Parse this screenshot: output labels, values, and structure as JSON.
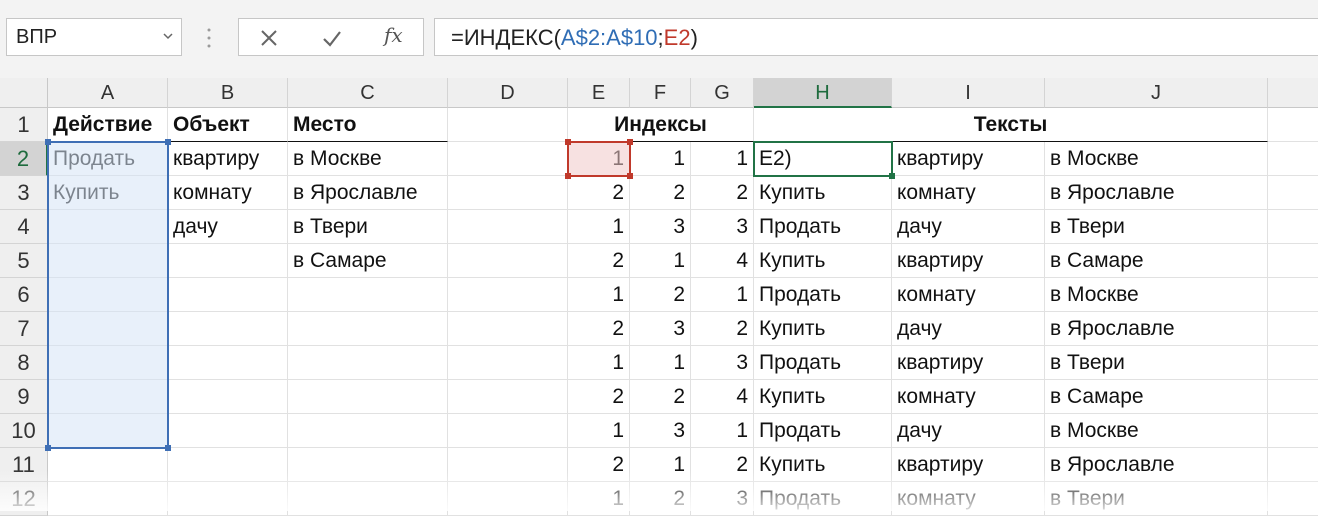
{
  "name_box": {
    "value": "ВПР"
  },
  "formula_bar": {
    "prefix": "=ИНДЕКС(",
    "ref1": "A$2:A$10",
    "sep": ";",
    "ref2": "E2",
    "suffix": ")",
    "cancel_icon": "close-icon",
    "enter_icon": "check-icon",
    "function_icon": "fx-icon",
    "fx_label": "fx"
  },
  "columns": [
    "A",
    "B",
    "C",
    "D",
    "E",
    "F",
    "G",
    "H",
    "I",
    "J"
  ],
  "active_column": "H",
  "rows": [
    "1",
    "2",
    "3",
    "4",
    "5",
    "6",
    "7",
    "8",
    "9",
    "10",
    "11",
    "12"
  ],
  "active_row": "2",
  "header_row": {
    "A": "Действие",
    "B": "Объект",
    "C": "Место",
    "EFG": "Индексы",
    "HIJ": "Тексты"
  },
  "source": {
    "actions": [
      "Продать",
      "Купить"
    ],
    "objects": [
      "квартиру",
      "комнату",
      "дачу"
    ],
    "places": [
      "в Москве",
      "в Ярославле",
      "в Твери",
      "в Самаре"
    ]
  },
  "table": [
    {
      "e": "1",
      "f": "1",
      "g": "1",
      "h": "E2)",
      "i": "квартиру",
      "j": "в Москве"
    },
    {
      "e": "2",
      "f": "2",
      "g": "2",
      "h": "Купить",
      "i": "комнату",
      "j": "в Ярославле"
    },
    {
      "e": "1",
      "f": "3",
      "g": "3",
      "h": "Продать",
      "i": "дачу",
      "j": "в Твери"
    },
    {
      "e": "2",
      "f": "1",
      "g": "4",
      "h": "Купить",
      "i": "квартиру",
      "j": "в Самаре"
    },
    {
      "e": "1",
      "f": "2",
      "g": "1",
      "h": "Продать",
      "i": "комнату",
      "j": "в Москве"
    },
    {
      "e": "2",
      "f": "3",
      "g": "2",
      "h": "Купить",
      "i": "дачу",
      "j": "в Ярославле"
    },
    {
      "e": "1",
      "f": "1",
      "g": "3",
      "h": "Продать",
      "i": "квартиру",
      "j": "в Твери"
    },
    {
      "e": "2",
      "f": "2",
      "g": "4",
      "h": "Купить",
      "i": "комнату",
      "j": "в Самаре"
    },
    {
      "e": "1",
      "f": "3",
      "g": "1",
      "h": "Продать",
      "i": "дачу",
      "j": "в Москве"
    },
    {
      "e": "2",
      "f": "1",
      "g": "2",
      "h": "Купить",
      "i": "квартиру",
      "j": "в Ярославле"
    },
    {
      "e": "1",
      "f": "2",
      "g": "3",
      "h": "Продать",
      "i": "комнату",
      "j": "в Твери"
    }
  ],
  "colors": {
    "range_a": "#3f6fb5",
    "range_e": "#c0392b",
    "active_cell": "#217346"
  }
}
